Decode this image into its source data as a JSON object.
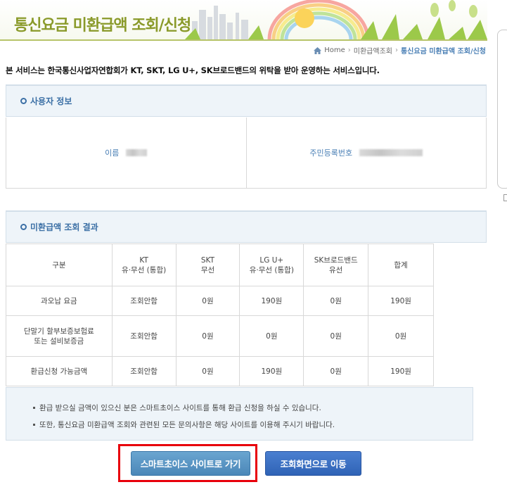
{
  "banner": {
    "title": "통신요금 미환급액 조회/신청"
  },
  "breadcrumb": {
    "home": "Home",
    "level1": "미환급액조회",
    "current": "통신요금 미환급액 조회/신청",
    "separator": "›"
  },
  "notice": "본 서비스는 한국통신사업자연합회가 KT, SKT, LG U+, SK브로드밴드의 위탁을 받아 운영하는 서비스입니다.",
  "user_section": {
    "title": "사용자 정보",
    "name_label": "이름",
    "id_label": "주민등록번호"
  },
  "result_section": {
    "title": "미환급액 조회 결과",
    "headers": [
      {
        "line1": "구분",
        "line2": ""
      },
      {
        "line1": "KT",
        "line2": "유·무선 (통합)"
      },
      {
        "line1": "SKT",
        "line2": "무선"
      },
      {
        "line1": "LG U+",
        "line2": "유·무선 (통합)"
      },
      {
        "line1": "SK브로드밴드",
        "line2": "유선"
      },
      {
        "line1": "합계",
        "line2": ""
      }
    ],
    "rows": [
      {
        "label1": "과오납 요금",
        "label2": "",
        "kt": "조회안함",
        "skt": "0원",
        "lgu": "190원",
        "skb": "0원",
        "total": "190원"
      },
      {
        "label1": "단말기 할부보증보험료",
        "label2": "또는 설비보증금",
        "kt": "조회안함",
        "skt": "0원",
        "lgu": "0원",
        "skb": "0원",
        "total": "0원"
      },
      {
        "label1": "환급신청 가능금액",
        "label2": "",
        "kt": "조회안함",
        "skt": "0원",
        "lgu": "190원",
        "skb": "0원",
        "total": "190원"
      }
    ]
  },
  "info": {
    "line1": "환급 받으실 금액이 있으신 분은 스마트초이스 사이트를 통해 환급 신청을 하실 수 있습니다.",
    "line2": "또한, 통신요금 미환급액 조회와 관련된 모든 문의사항은 해당 사이트를 이용해 주시기 바랍니다."
  },
  "buttons": {
    "smartchoice": "스마트초이스 사이트로 가기",
    "back": "조회화면으로 이동"
  },
  "colors": {
    "accent": "#3b6fa5",
    "title_green": "#8a9a2a",
    "highlight": "#e8000b"
  }
}
